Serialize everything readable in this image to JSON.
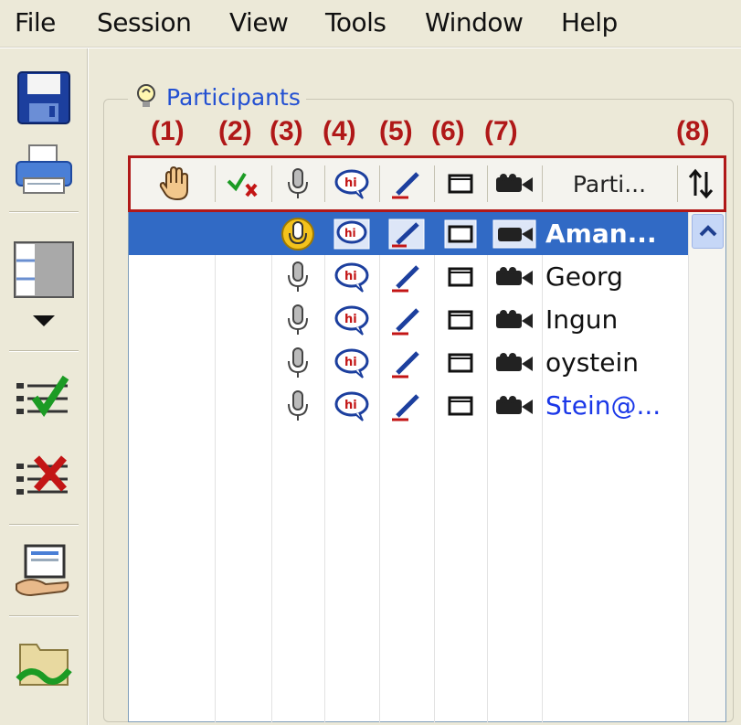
{
  "menu": {
    "items": [
      {
        "label": "File"
      },
      {
        "label": "Session"
      },
      {
        "label": "View"
      },
      {
        "label": "Tools"
      },
      {
        "label": "Window"
      },
      {
        "label": "Help"
      }
    ]
  },
  "toolbar": {
    "buttons": [
      {
        "icon": "save-icon"
      },
      {
        "icon": "print-icon"
      },
      {
        "icon": "layout-icon"
      },
      {
        "icon": "dropdown-arrow-icon"
      },
      {
        "icon": "approve-list-icon"
      },
      {
        "icon": "reject-list-icon"
      },
      {
        "icon": "share-screen-icon"
      },
      {
        "icon": "open-folder-icon"
      }
    ]
  },
  "panel": {
    "title": "Participants",
    "title_icon": "lightbulb-icon"
  },
  "annotations": [
    "(1)",
    "(2)",
    "(3)",
    "(4)",
    "(5)",
    "(6)",
    "(7)",
    "(8)"
  ],
  "header": {
    "columns": [
      {
        "icon": "raise-hand-icon"
      },
      {
        "icon": "approve-reject-icon"
      },
      {
        "icon": "microphone-icon"
      },
      {
        "icon": "chat-icon"
      },
      {
        "icon": "pen-icon"
      },
      {
        "icon": "window-icon"
      },
      {
        "icon": "camera-icon"
      }
    ],
    "name_label": "Parti...",
    "sort_icon": "sort-icon"
  },
  "participants": [
    {
      "name": "Aman...",
      "selected": true,
      "color": "#ffffff"
    },
    {
      "name": "Georg",
      "selected": false,
      "color": "#111111"
    },
    {
      "name": "Ingun",
      "selected": false,
      "color": "#111111"
    },
    {
      "name": "oystein",
      "selected": false,
      "color": "#111111"
    },
    {
      "name": "Stein@...",
      "selected": false,
      "color": "#1a37e8"
    }
  ],
  "colors": {
    "selection": "#316ac5",
    "annotation": "#b01818",
    "title": "#2350d2"
  }
}
